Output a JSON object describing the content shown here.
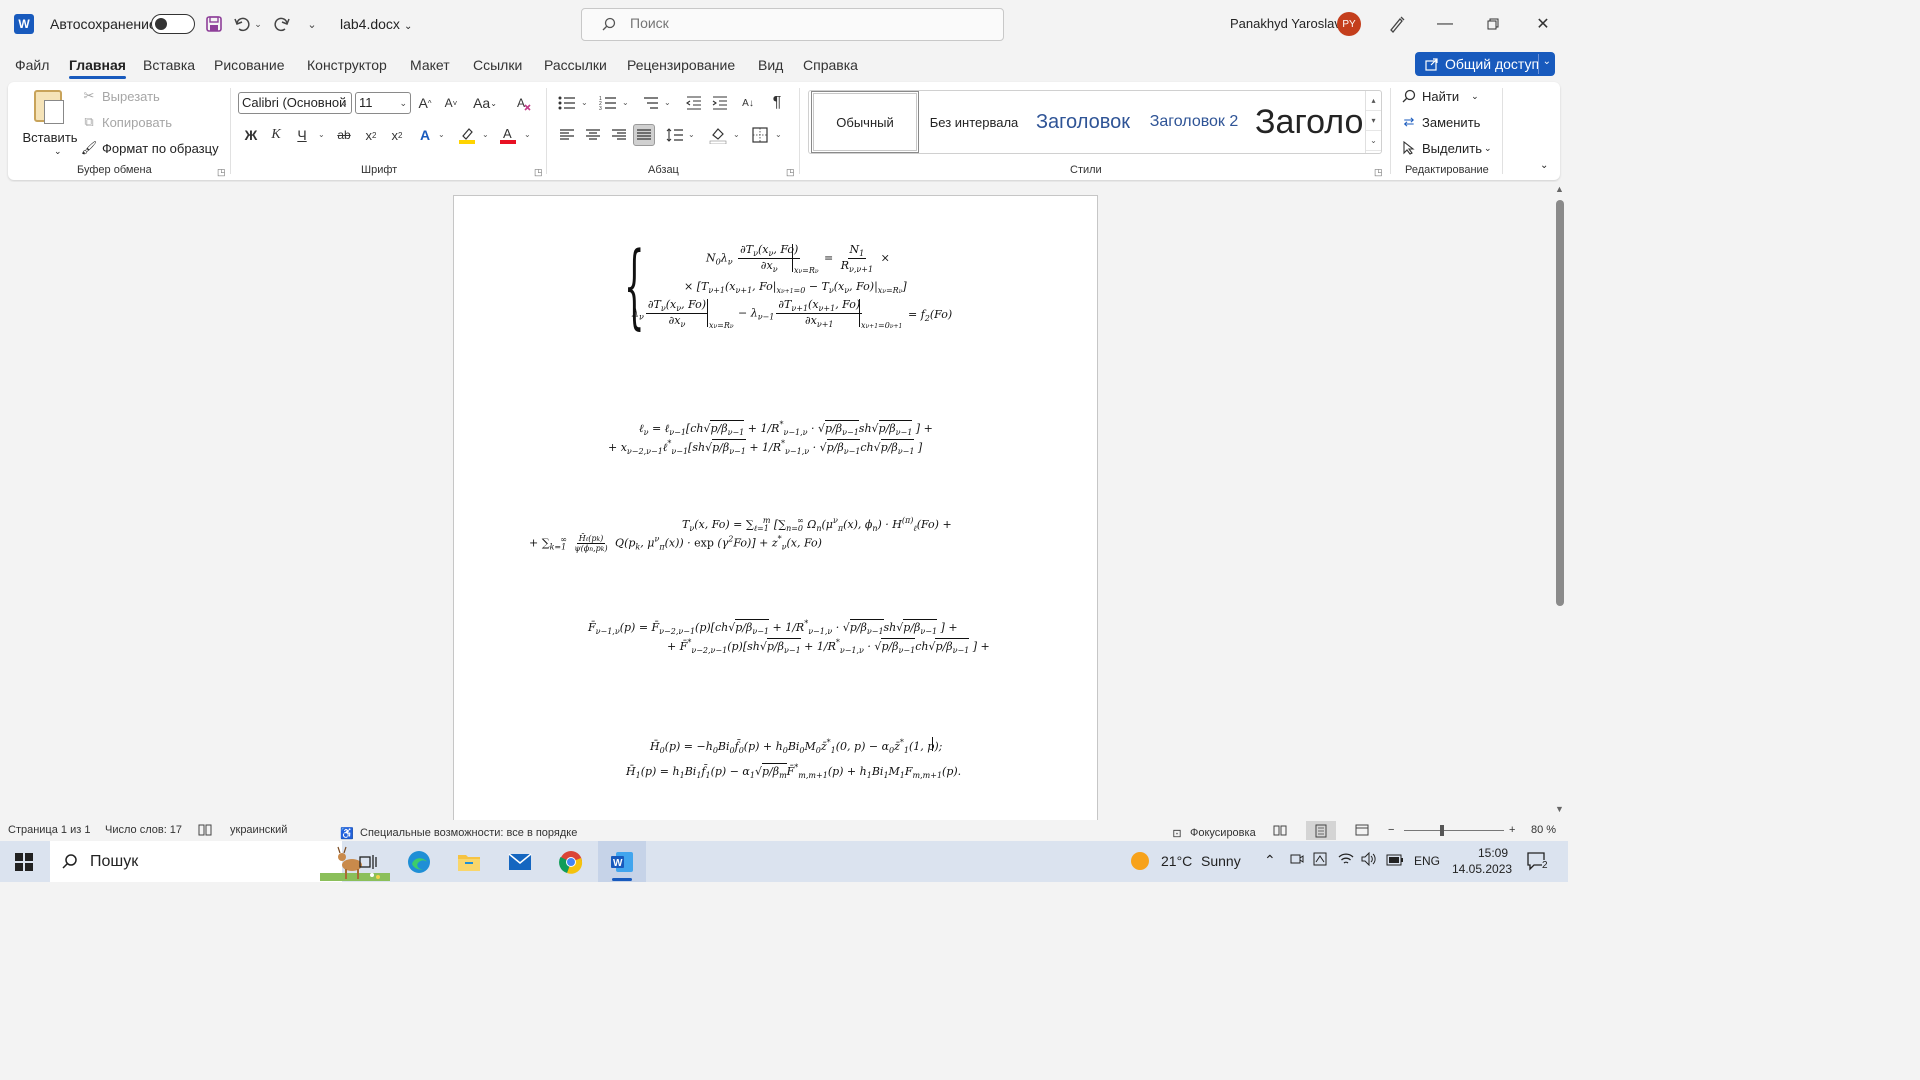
{
  "titlebar": {
    "app_logo": "W",
    "autosave_label": "Автосохранение",
    "filename": "lab4.docx",
    "search_placeholder": "Поиск",
    "user_name": "Panakhyd Yaroslav",
    "user_initials": "PY"
  },
  "menu": {
    "tabs": [
      "Файл",
      "Главная",
      "Вставка",
      "Рисование",
      "Конструктор",
      "Макет",
      "Ссылки",
      "Рассылки",
      "Рецензирование",
      "Вид",
      "Справка"
    ],
    "active_tab": "Главная",
    "share_label": "Общий доступ"
  },
  "ribbon": {
    "clipboard": {
      "paste": "Вставить",
      "cut": "Вырезать",
      "copy": "Копировать",
      "format_painter": "Формат по образцу",
      "group_label": "Буфер обмена"
    },
    "font": {
      "font_name": "Calibri (Основной",
      "font_size": "11",
      "bold": "Ж",
      "italic": "К",
      "underline": "Ч",
      "strike": "ab",
      "group_label": "Шрифт"
    },
    "paragraph": {
      "group_label": "Абзац"
    },
    "styles": {
      "items": [
        "Обычный",
        "Без интервала",
        "Заголовок",
        "Заголовок 2",
        "Заголовок"
      ],
      "group_label": "Стили"
    },
    "editing": {
      "find": "Найти",
      "replace": "Заменить",
      "select": "Выделить",
      "group_label": "Редактирование"
    },
    "colors": {
      "accent": "#185abd",
      "highlight": "#ffd400",
      "font_color": "#e81123"
    }
  },
  "status": {
    "page": "Страница 1 из 1",
    "words": "Число слов: 17",
    "language": "украинский",
    "accessibility": "Специальные возможности: все в порядке",
    "focus": "Фокусировка",
    "zoom": "80 %"
  },
  "taskbar": {
    "search_label": "Пошук",
    "weather_temp": "21°C",
    "weather_text": "Sunny",
    "lang": "ENG",
    "time": "15:09",
    "date": "14.05.2023",
    "notifications": "2"
  }
}
